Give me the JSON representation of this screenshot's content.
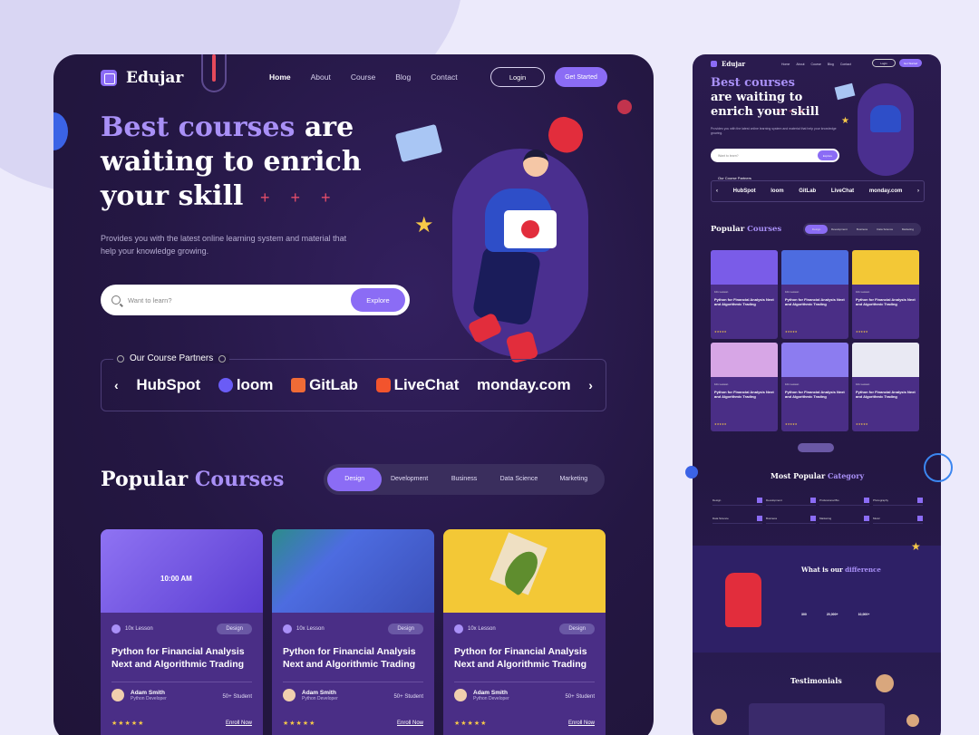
{
  "brand": {
    "name": "Edujar",
    "accent": "#8b6cf5",
    "accent_light": "#a990f7",
    "bg_dark": "#241743",
    "star": "#f7c948"
  },
  "nav": {
    "items": [
      "Home",
      "About",
      "Course",
      "Blog",
      "Contact"
    ],
    "login": "Login",
    "get_started": "Get Started"
  },
  "hero": {
    "title_accent": "Best courses",
    "title_rest": " are waiting to enrich your skill",
    "plus": "+ + +",
    "description": "Provides you with the latest online learning system and material that help your knowledge growing."
  },
  "search": {
    "placeholder": "Want to learn?",
    "button": "Explore"
  },
  "partners": {
    "label": "Our Course Partners",
    "items": [
      "HubSpot",
      "loom",
      "GitLab",
      "LiveChat",
      "monday.com"
    ]
  },
  "popular": {
    "title": "Popular",
    "title_accent": "Courses",
    "tabs": [
      "Design",
      "Development",
      "Business",
      "Data Science",
      "Marketing"
    ]
  },
  "courses": [
    {
      "lessons": "10x Lesson",
      "tag": "Design",
      "title": "Python for Financial Analysis Next and Algorithmic Trading",
      "author": "Adam Smith",
      "role": "Python Developer",
      "students": "50+ Student",
      "stars": "★★★★★",
      "enroll": "Enroll Now",
      "image_color": "#7a5ce8",
      "image_text": "10:00 AM"
    },
    {
      "lessons": "10x Lesson",
      "tag": "Design",
      "title": "Python for Financial Analysis Next and Algorithmic Trading",
      "author": "Adam Smith",
      "role": "Python Developer",
      "students": "50+ Student",
      "stars": "★★★★★",
      "enroll": "Enroll Now",
      "image_color": "#4d6ce0"
    },
    {
      "lessons": "10x Lesson",
      "tag": "Design",
      "title": "Python for Financial Analysis Next and Algorithmic Trading",
      "author": "Adam Smith",
      "role": "Python Developer",
      "students": "50+ Student",
      "stars": "★★★★★",
      "enroll": "Enroll Now",
      "image_color": "#f3c836"
    }
  ],
  "mini": {
    "most_popular": "Most Popular",
    "category": "Category",
    "categories": [
      "Design",
      "Development",
      "Professional Bio",
      "Photography",
      "Data Science",
      "Business",
      "Marketing",
      "Music"
    ],
    "what_is": "What is our",
    "difference": "difference",
    "stats": [
      "300",
      "20,000+",
      "10,000+"
    ],
    "testimonials": "Testimonials",
    "mini_card_title": "Python for Financial Analysis Next and Algorithmic Trading",
    "mini_card_colors": [
      "#7a5ce8",
      "#4d6ce0",
      "#f3c836",
      "#d7a6e6",
      "#8c7cf0",
      "#e9e9f3"
    ]
  }
}
